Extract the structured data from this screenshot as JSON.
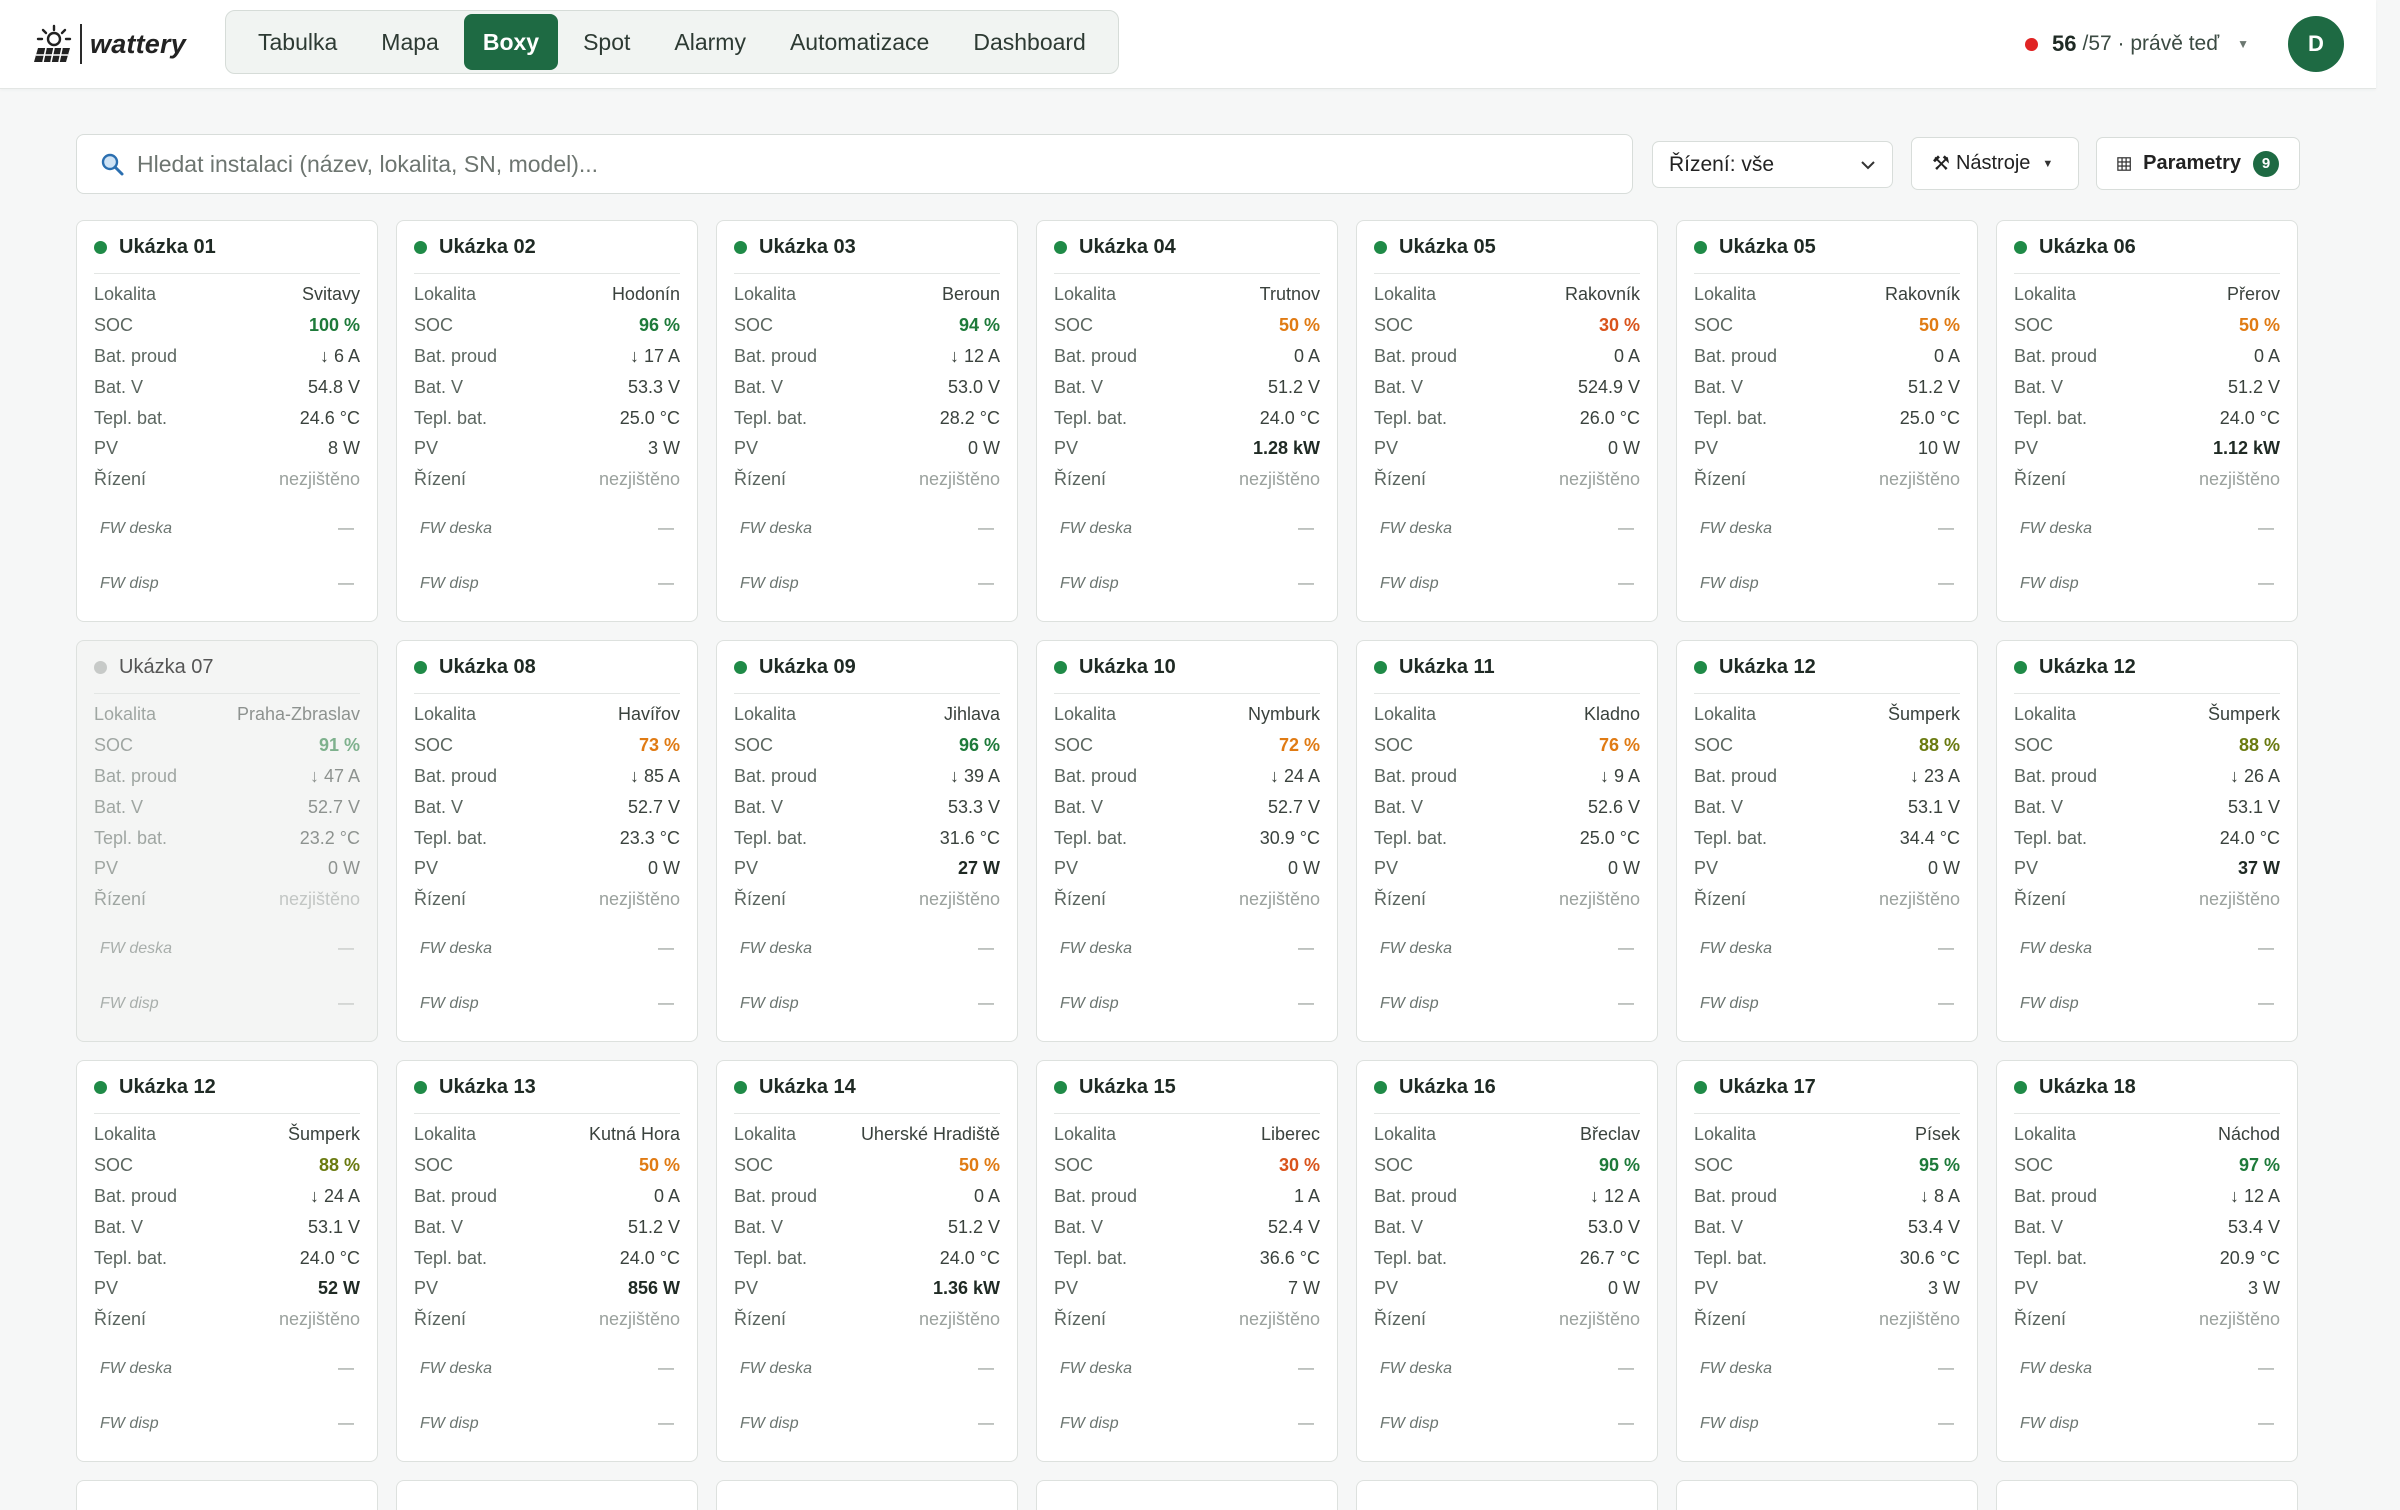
{
  "brand": {
    "name": "wattery"
  },
  "nav": {
    "tabs": [
      "Tabulka",
      "Mapa",
      "Boxy",
      "Spot",
      "Alarmy",
      "Automatizace",
      "Dashboard"
    ],
    "active": "Boxy"
  },
  "status": {
    "online": "56",
    "total": "/57 · právě teď"
  },
  "user": {
    "initial": "D"
  },
  "toolbar": {
    "search_placeholder": "Hledat instalaci (název, lokalita, SN, model)...",
    "control_select": "Řízení: vše",
    "tools_label": "Nástroje",
    "params_label": "Parametry",
    "params_count": "9"
  },
  "labels": {
    "lokalita": "Lokalita",
    "soc": "SOC",
    "bat_proud": "Bat. proud",
    "bat_v": "Bat. V",
    "tepl_bat": "Tepl. bat.",
    "pv": "PV",
    "rizeni": "Řízení",
    "fw_deska": "FW deska",
    "fw_disp": "FW disp"
  },
  "colors": {
    "accent": "#1e6a43",
    "online": "#1f8a47",
    "offline": "#c7cac8",
    "alert": "#e02424"
  },
  "cards": [
    {
      "name": "Ukázka 01",
      "lokalita": "Svitavy",
      "soc": "100 %",
      "soc_level": "good",
      "proud": "↓ 6 A",
      "bat_v": "54.8 V",
      "tepl": "24.6 °C",
      "pv": "8 W",
      "pv_bold": false,
      "rizeni": "nezjištěno",
      "fw_deska": "—",
      "fw_disp": "—",
      "online": true
    },
    {
      "name": "Ukázka 02",
      "lokalita": "Hodonín",
      "soc": "96 %",
      "soc_level": "good",
      "proud": "↓ 17 A",
      "bat_v": "53.3 V",
      "tepl": "25.0 °C",
      "pv": "3 W",
      "pv_bold": false,
      "rizeni": "nezjištěno",
      "fw_deska": "—",
      "fw_disp": "—",
      "online": true
    },
    {
      "name": "Ukázka 03",
      "lokalita": "Beroun",
      "soc": "94 %",
      "soc_level": "good",
      "proud": "↓ 12 A",
      "bat_v": "53.0 V",
      "tepl": "28.2 °C",
      "pv": "0 W",
      "pv_bold": false,
      "rizeni": "nezjištěno",
      "fw_deska": "—",
      "fw_disp": "—",
      "online": true
    },
    {
      "name": "Ukázka 04",
      "lokalita": "Trutnov",
      "soc": "50 %",
      "soc_level": "warn",
      "proud": "0 A",
      "bat_v": "51.2 V",
      "tepl": "24.0 °C",
      "pv": "1.28 kW",
      "pv_bold": true,
      "rizeni": "nezjištěno",
      "fw_deska": "—",
      "fw_disp": "—",
      "online": true
    },
    {
      "name": "Ukázka 05",
      "lokalita": "Rakovník",
      "soc": "30 %",
      "soc_level": "low",
      "proud": "0 A",
      "bat_v": "524.9 V",
      "tepl": "26.0 °C",
      "pv": "0 W",
      "pv_bold": false,
      "rizeni": "nezjištěno",
      "fw_deska": "—",
      "fw_disp": "—",
      "online": true
    },
    {
      "name": "Ukázka 05",
      "lokalita": "Rakovník",
      "soc": "50 %",
      "soc_level": "warn",
      "proud": "0 A",
      "bat_v": "51.2 V",
      "tepl": "25.0 °C",
      "pv": "10 W",
      "pv_bold": false,
      "rizeni": "nezjištěno",
      "fw_deska": "—",
      "fw_disp": "—",
      "online": true
    },
    {
      "name": "Ukázka 06",
      "lokalita": "Přerov",
      "soc": "50 %",
      "soc_level": "warn",
      "proud": "0 A",
      "bat_v": "51.2 V",
      "tepl": "24.0 °C",
      "pv": "1.12 kW",
      "pv_bold": true,
      "rizeni": "nezjištěno",
      "fw_deska": "—",
      "fw_disp": "—",
      "online": true
    },
    {
      "name": "Ukázka 07",
      "lokalita": "Praha-Zbraslav",
      "soc": "91 %",
      "soc_level": "good",
      "proud": "↓ 47 A",
      "bat_v": "52.7 V",
      "tepl": "23.2 °C",
      "pv": "0 W",
      "pv_bold": false,
      "rizeni": "nezjištěno",
      "fw_deska": "—",
      "fw_disp": "—",
      "online": false
    },
    {
      "name": "Ukázka 08",
      "lokalita": "Havířov",
      "soc": "73 %",
      "soc_level": "warn",
      "proud": "↓ 85 A",
      "bat_v": "52.7 V",
      "tepl": "23.3 °C",
      "pv": "0 W",
      "pv_bold": false,
      "rizeni": "nezjištěno",
      "fw_deska": "—",
      "fw_disp": "—",
      "online": true
    },
    {
      "name": "Ukázka 09",
      "lokalita": "Jihlava",
      "soc": "96 %",
      "soc_level": "good",
      "proud": "↓ 39 A",
      "bat_v": "53.3 V",
      "tepl": "31.6 °C",
      "pv": "27 W",
      "pv_bold": true,
      "rizeni": "nezjištěno",
      "fw_deska": "—",
      "fw_disp": "—",
      "online": true
    },
    {
      "name": "Ukázka 10",
      "lokalita": "Nymburk",
      "soc": "72 %",
      "soc_level": "warn",
      "proud": "↓ 24 A",
      "bat_v": "52.7 V",
      "tepl": "30.9 °C",
      "pv": "0 W",
      "pv_bold": false,
      "rizeni": "nezjištěno",
      "fw_deska": "—",
      "fw_disp": "—",
      "online": true
    },
    {
      "name": "Ukázka 11",
      "lokalita": "Kladno",
      "soc": "76 %",
      "soc_level": "warn",
      "proud": "↓ 9 A",
      "bat_v": "52.6 V",
      "tepl": "25.0 °C",
      "pv": "0 W",
      "pv_bold": false,
      "rizeni": "nezjištěno",
      "fw_deska": "—",
      "fw_disp": "—",
      "online": true
    },
    {
      "name": "Ukázka 12",
      "lokalita": "Šumperk",
      "soc": "88 %",
      "soc_level": "mid",
      "proud": "↓ 23 A",
      "bat_v": "53.1 V",
      "tepl": "34.4 °C",
      "pv": "0 W",
      "pv_bold": false,
      "rizeni": "nezjištěno",
      "fw_deska": "—",
      "fw_disp": "—",
      "online": true
    },
    {
      "name": "Ukázka 12",
      "lokalita": "Šumperk",
      "soc": "88 %",
      "soc_level": "mid",
      "proud": "↓ 26 A",
      "bat_v": "53.1 V",
      "tepl": "24.0 °C",
      "pv": "37 W",
      "pv_bold": true,
      "rizeni": "nezjištěno",
      "fw_deska": "—",
      "fw_disp": "—",
      "online": true
    },
    {
      "name": "Ukázka 12",
      "lokalita": "Šumperk",
      "soc": "88 %",
      "soc_level": "mid",
      "proud": "↓ 24 A",
      "bat_v": "53.1 V",
      "tepl": "24.0 °C",
      "pv": "52 W",
      "pv_bold": true,
      "rizeni": "nezjištěno",
      "fw_deska": "—",
      "fw_disp": "—",
      "online": true
    },
    {
      "name": "Ukázka 13",
      "lokalita": "Kutná Hora",
      "soc": "50 %",
      "soc_level": "warn",
      "proud": "0 A",
      "bat_v": "51.2 V",
      "tepl": "24.0 °C",
      "pv": "856 W",
      "pv_bold": true,
      "rizeni": "nezjištěno",
      "fw_deska": "—",
      "fw_disp": "—",
      "online": true
    },
    {
      "name": "Ukázka 14",
      "lokalita": "Uherské Hradiště",
      "soc": "50 %",
      "soc_level": "warn",
      "proud": "0 A",
      "bat_v": "51.2 V",
      "tepl": "24.0 °C",
      "pv": "1.36 kW",
      "pv_bold": true,
      "rizeni": "nezjištěno",
      "fw_deska": "—",
      "fw_disp": "—",
      "online": true
    },
    {
      "name": "Ukázka 15",
      "lokalita": "Liberec",
      "soc": "30 %",
      "soc_level": "low",
      "proud": "1 A",
      "bat_v": "52.4 V",
      "tepl": "36.6 °C",
      "pv": "7 W",
      "pv_bold": false,
      "rizeni": "nezjištěno",
      "fw_deska": "—",
      "fw_disp": "—",
      "online": true
    },
    {
      "name": "Ukázka 16",
      "lokalita": "Břeclav",
      "soc": "90 %",
      "soc_level": "good",
      "proud": "↓ 12 A",
      "bat_v": "53.0 V",
      "tepl": "26.7 °C",
      "pv": "0 W",
      "pv_bold": false,
      "rizeni": "nezjištěno",
      "fw_deska": "—",
      "fw_disp": "—",
      "online": true
    },
    {
      "name": "Ukázka 17",
      "lokalita": "Písek",
      "soc": "95 %",
      "soc_level": "good",
      "proud": "↓ 8 A",
      "bat_v": "53.4 V",
      "tepl": "30.6 °C",
      "pv": "3 W",
      "pv_bold": false,
      "rizeni": "nezjištěno",
      "fw_deska": "—",
      "fw_disp": "—",
      "online": true
    },
    {
      "name": "Ukázka 18",
      "lokalita": "Náchod",
      "soc": "97 %",
      "soc_level": "good",
      "proud": "↓ 12 A",
      "bat_v": "53.4 V",
      "tepl": "20.9 °C",
      "pv": "3 W",
      "pv_bold": false,
      "rizeni": "nezjištěno",
      "fw_deska": "—",
      "fw_disp": "—",
      "online": true
    }
  ]
}
